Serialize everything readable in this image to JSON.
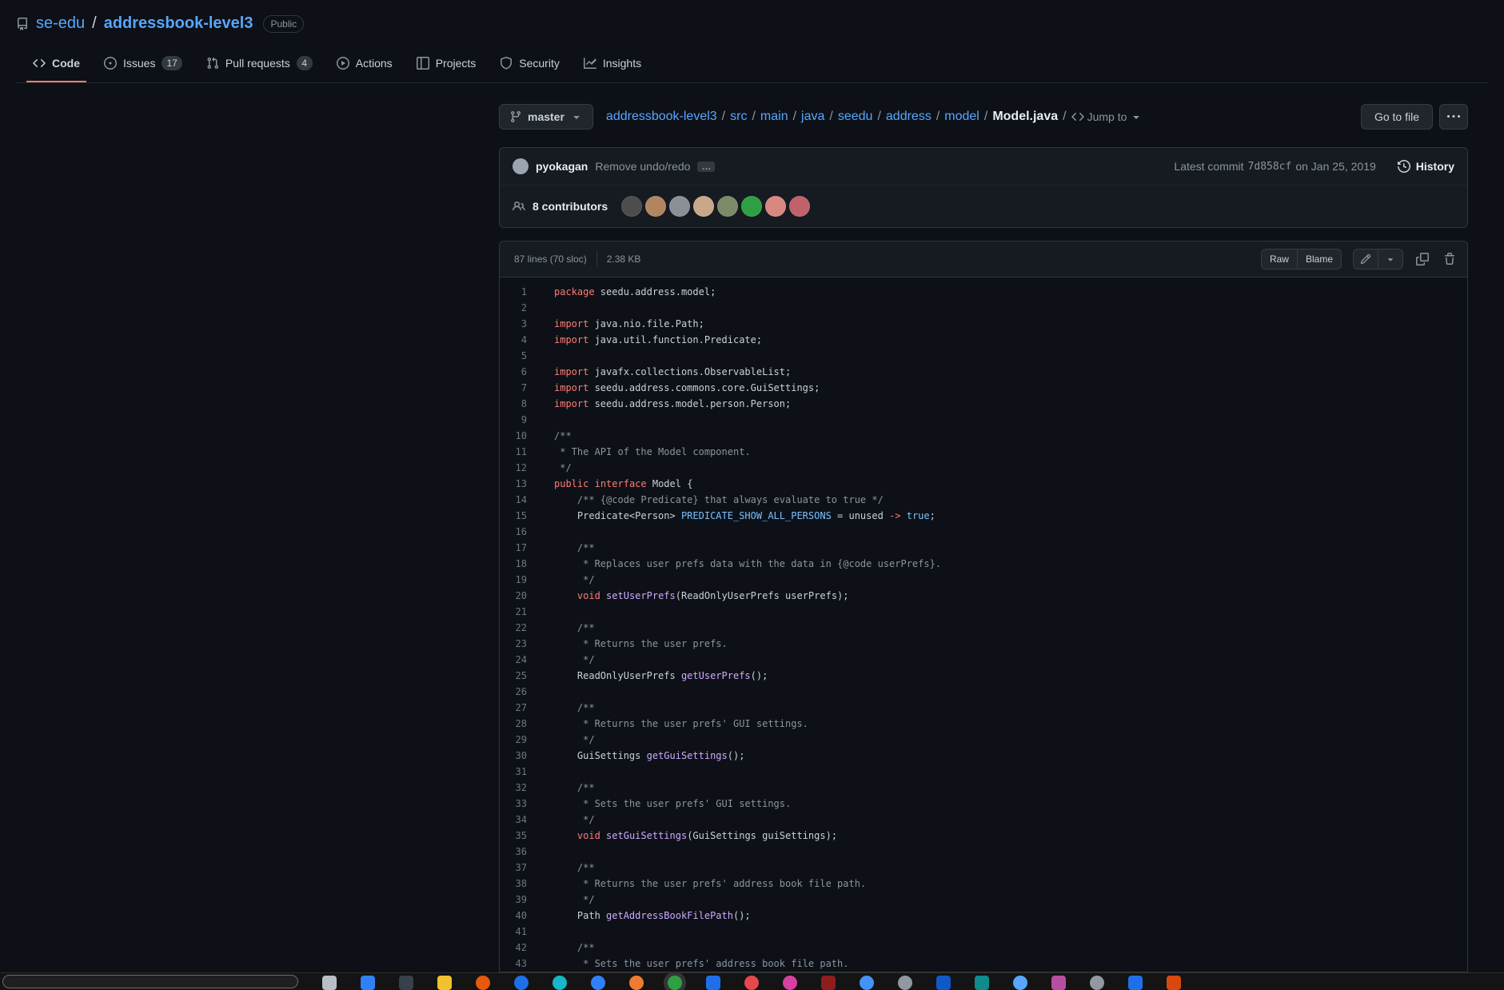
{
  "colors": {
    "k": "#ff7b72",
    "c": "#8b949e",
    "f": "#d2a8ff",
    "v": "#79c0ff",
    "accent": "#f78166",
    "link": "#58a6ff"
  },
  "header": {
    "owner": "se-edu",
    "sep": "/",
    "repo": "addressbook-level3",
    "visibility": "Public",
    "tabs": [
      {
        "label": "Code",
        "icon": "code-icon",
        "active": true
      },
      {
        "label": "Issues",
        "icon": "issue-opened-icon",
        "count": "17"
      },
      {
        "label": "Pull requests",
        "icon": "git-pull-request-icon",
        "count": "4"
      },
      {
        "label": "Actions",
        "icon": "play-icon"
      },
      {
        "label": "Projects",
        "icon": "project-icon"
      },
      {
        "label": "Security",
        "icon": "shield-icon"
      },
      {
        "label": "Insights",
        "icon": "graph-icon"
      }
    ]
  },
  "file_nav": {
    "branch": "master",
    "path": [
      "addressbook-level3",
      "src",
      "main",
      "java",
      "seedu",
      "address",
      "model"
    ],
    "file": "Model.java",
    "separator": "/",
    "jump_to": "Jump to",
    "go_to_file": "Go to file"
  },
  "commit": {
    "author": "pyokagan",
    "message": "Remove undo/redo",
    "ellipsis": "…",
    "latest_prefix": "Latest commit",
    "sha": "7d858cf",
    "date_suffix": "on Jan 25, 2019",
    "history": "History"
  },
  "contributors": {
    "label": "8 contributors",
    "avatars": [
      "#4d4d4d",
      "#b0855f",
      "#8a8f98",
      "#c9a88a",
      "#7d8a6a",
      "#2ea043",
      "#d98880",
      "#c0626a"
    ]
  },
  "file_meta": {
    "lines_info": "87 lines (70 sloc)",
    "size": "2.38 KB",
    "raw": "Raw",
    "blame": "Blame"
  },
  "code": {
    "lines": [
      {
        "n": "1",
        "s": [
          [
            "k",
            "package"
          ],
          [
            "",
            " seedu.address.model;"
          ]
        ]
      },
      {
        "n": "2",
        "s": []
      },
      {
        "n": "3",
        "s": [
          [
            "k",
            "import"
          ],
          [
            "",
            " java.nio.file.Path;"
          ]
        ]
      },
      {
        "n": "4",
        "s": [
          [
            "k",
            "import"
          ],
          [
            "",
            " java.util.function.Predicate;"
          ]
        ]
      },
      {
        "n": "5",
        "s": []
      },
      {
        "n": "6",
        "s": [
          [
            "k",
            "import"
          ],
          [
            "",
            " javafx.collections.ObservableList;"
          ]
        ]
      },
      {
        "n": "7",
        "s": [
          [
            "k",
            "import"
          ],
          [
            "",
            " seedu.address.commons.core.GuiSettings;"
          ]
        ]
      },
      {
        "n": "8",
        "s": [
          [
            "k",
            "import"
          ],
          [
            "",
            " seedu.address.model.person.Person;"
          ]
        ]
      },
      {
        "n": "9",
        "s": []
      },
      {
        "n": "10",
        "s": [
          [
            "c",
            "/**"
          ]
        ]
      },
      {
        "n": "11",
        "s": [
          [
            "c",
            " * The API of the Model component."
          ]
        ]
      },
      {
        "n": "12",
        "s": [
          [
            "c",
            " */"
          ]
        ]
      },
      {
        "n": "13",
        "s": [
          [
            "k",
            "public"
          ],
          [
            "",
            " "
          ],
          [
            "k",
            "interface"
          ],
          [
            "",
            " Model {"
          ]
        ]
      },
      {
        "n": "14",
        "s": [
          [
            "",
            "    "
          ],
          [
            "c",
            "/** {@code Predicate} that always evaluate to true */"
          ]
        ]
      },
      {
        "n": "15",
        "s": [
          [
            "",
            "    Predicate<Person> "
          ],
          [
            "v",
            "PREDICATE_SHOW_ALL_PERSONS"
          ],
          [
            "",
            " = unused "
          ],
          [
            "k",
            "->"
          ],
          [
            "",
            " "
          ],
          [
            "v",
            "true"
          ],
          [
            "",
            ";"
          ]
        ]
      },
      {
        "n": "16",
        "s": []
      },
      {
        "n": "17",
        "s": [
          [
            "",
            "    "
          ],
          [
            "c",
            "/**"
          ]
        ]
      },
      {
        "n": "18",
        "s": [
          [
            "",
            "    "
          ],
          [
            "c",
            " * Replaces user prefs data with the data in {@code userPrefs}."
          ]
        ]
      },
      {
        "n": "19",
        "s": [
          [
            "",
            "    "
          ],
          [
            "c",
            " */"
          ]
        ]
      },
      {
        "n": "20",
        "s": [
          [
            "",
            "    "
          ],
          [
            "k",
            "void"
          ],
          [
            "",
            " "
          ],
          [
            "f",
            "setUserPrefs"
          ],
          [
            "",
            "(ReadOnlyUserPrefs userPrefs);"
          ]
        ]
      },
      {
        "n": "21",
        "s": []
      },
      {
        "n": "22",
        "s": [
          [
            "",
            "    "
          ],
          [
            "c",
            "/**"
          ]
        ]
      },
      {
        "n": "23",
        "s": [
          [
            "",
            "    "
          ],
          [
            "c",
            " * Returns the user prefs."
          ]
        ]
      },
      {
        "n": "24",
        "s": [
          [
            "",
            "    "
          ],
          [
            "c",
            " */"
          ]
        ]
      },
      {
        "n": "25",
        "s": [
          [
            "",
            "    ReadOnlyUserPrefs "
          ],
          [
            "f",
            "getUserPrefs"
          ],
          [
            "",
            "();"
          ]
        ]
      },
      {
        "n": "26",
        "s": []
      },
      {
        "n": "27",
        "s": [
          [
            "",
            "    "
          ],
          [
            "c",
            "/**"
          ]
        ]
      },
      {
        "n": "28",
        "s": [
          [
            "",
            "    "
          ],
          [
            "c",
            " * Returns the user prefs' GUI settings."
          ]
        ]
      },
      {
        "n": "29",
        "s": [
          [
            "",
            "    "
          ],
          [
            "c",
            " */"
          ]
        ]
      },
      {
        "n": "30",
        "s": [
          [
            "",
            "    GuiSettings "
          ],
          [
            "f",
            "getGuiSettings"
          ],
          [
            "",
            "();"
          ]
        ]
      },
      {
        "n": "31",
        "s": []
      },
      {
        "n": "32",
        "s": [
          [
            "",
            "    "
          ],
          [
            "c",
            "/**"
          ]
        ]
      },
      {
        "n": "33",
        "s": [
          [
            "",
            "    "
          ],
          [
            "c",
            " * Sets the user prefs' GUI settings."
          ]
        ]
      },
      {
        "n": "34",
        "s": [
          [
            "",
            "    "
          ],
          [
            "c",
            " */"
          ]
        ]
      },
      {
        "n": "35",
        "s": [
          [
            "",
            "    "
          ],
          [
            "k",
            "void"
          ],
          [
            "",
            " "
          ],
          [
            "f",
            "setGuiSettings"
          ],
          [
            "",
            "(GuiSettings guiSettings);"
          ]
        ]
      },
      {
        "n": "36",
        "s": []
      },
      {
        "n": "37",
        "s": [
          [
            "",
            "    "
          ],
          [
            "c",
            "/**"
          ]
        ]
      },
      {
        "n": "38",
        "s": [
          [
            "",
            "    "
          ],
          [
            "c",
            " * Returns the user prefs' address book file path."
          ]
        ]
      },
      {
        "n": "39",
        "s": [
          [
            "",
            "    "
          ],
          [
            "c",
            " */"
          ]
        ]
      },
      {
        "n": "40",
        "s": [
          [
            "",
            "    Path "
          ],
          [
            "f",
            "getAddressBookFilePath"
          ],
          [
            "",
            "();"
          ]
        ]
      },
      {
        "n": "41",
        "s": []
      },
      {
        "n": "42",
        "s": [
          [
            "",
            "    "
          ],
          [
            "c",
            "/**"
          ]
        ]
      },
      {
        "n": "43",
        "s": [
          [
            "",
            "    "
          ],
          [
            "c",
            " * Sets the user prefs' address book file path."
          ]
        ]
      }
    ]
  },
  "taskbar": {
    "icons": [
      {
        "color": "#b9bec4",
        "shape": "square"
      },
      {
        "color": "#2f81f7",
        "shape": "square"
      },
      {
        "color": "#384049",
        "shape": "square"
      },
      {
        "color": "#f2c12e",
        "shape": "square"
      },
      {
        "color": "#e8590c",
        "shape": "circle"
      },
      {
        "color": "#1f6feb",
        "shape": "circle"
      },
      {
        "color": "#18b6c9",
        "shape": "circle"
      },
      {
        "color": "#2f81f7",
        "shape": "circle"
      },
      {
        "color": "#ef7b30",
        "shape": "circle"
      },
      {
        "color": "#2ea043",
        "shape": "circle",
        "active": true
      },
      {
        "color": "#1f6feb",
        "shape": "square"
      },
      {
        "color": "#e5484d",
        "shape": "circle"
      },
      {
        "color": "#d6409f",
        "shape": "circle"
      },
      {
        "color": "#8f1d1d",
        "shape": "square"
      },
      {
        "color": "#4493f8",
        "shape": "circle"
      },
      {
        "color": "#9198a1",
        "shape": "circle"
      },
      {
        "color": "#1158c7",
        "shape": "square"
      },
      {
        "color": "#0f8b8d",
        "shape": "square"
      },
      {
        "color": "#58a6ff",
        "shape": "circle"
      },
      {
        "color": "#b84ea2",
        "shape": "square"
      },
      {
        "color": "#9198a1",
        "shape": "circle"
      },
      {
        "color": "#1f6feb",
        "shape": "square"
      },
      {
        "color": "#d9480f",
        "shape": "square"
      }
    ]
  }
}
